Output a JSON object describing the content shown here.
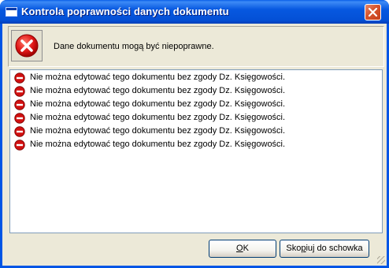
{
  "window": {
    "title": "Kontrola poprawności danych dokumentu",
    "header_message": "Dane dokumentu mogą być niepoprawne."
  },
  "messages": [
    "Nie można edytować tego dokumentu bez zgody Dz. Księgowości.",
    "Nie można edytować tego dokumentu bez zgody Dz. Księgowości.",
    "Nie można edytować tego dokumentu bez zgody Dz. Księgowości.",
    "Nie można edytować tego dokumentu bez zgody Dz. Księgowości.",
    "Nie można edytować tego dokumentu bez zgody Dz. Księgowości.",
    "Nie można edytować tego dokumentu bez zgody Dz. Księgowości."
  ],
  "buttons": {
    "ok": {
      "before": "",
      "accel": "O",
      "after": "K"
    },
    "copy": {
      "before": "Sko",
      "accel": "p",
      "after": "iuj do schowka"
    }
  },
  "icons": {
    "header": "error-icon",
    "row": "stop-icon",
    "close": "close-icon",
    "app": "window-icon"
  },
  "colors": {
    "titlebar": "#0558e0",
    "close": "#d6532c",
    "error_red": "#d11010"
  }
}
